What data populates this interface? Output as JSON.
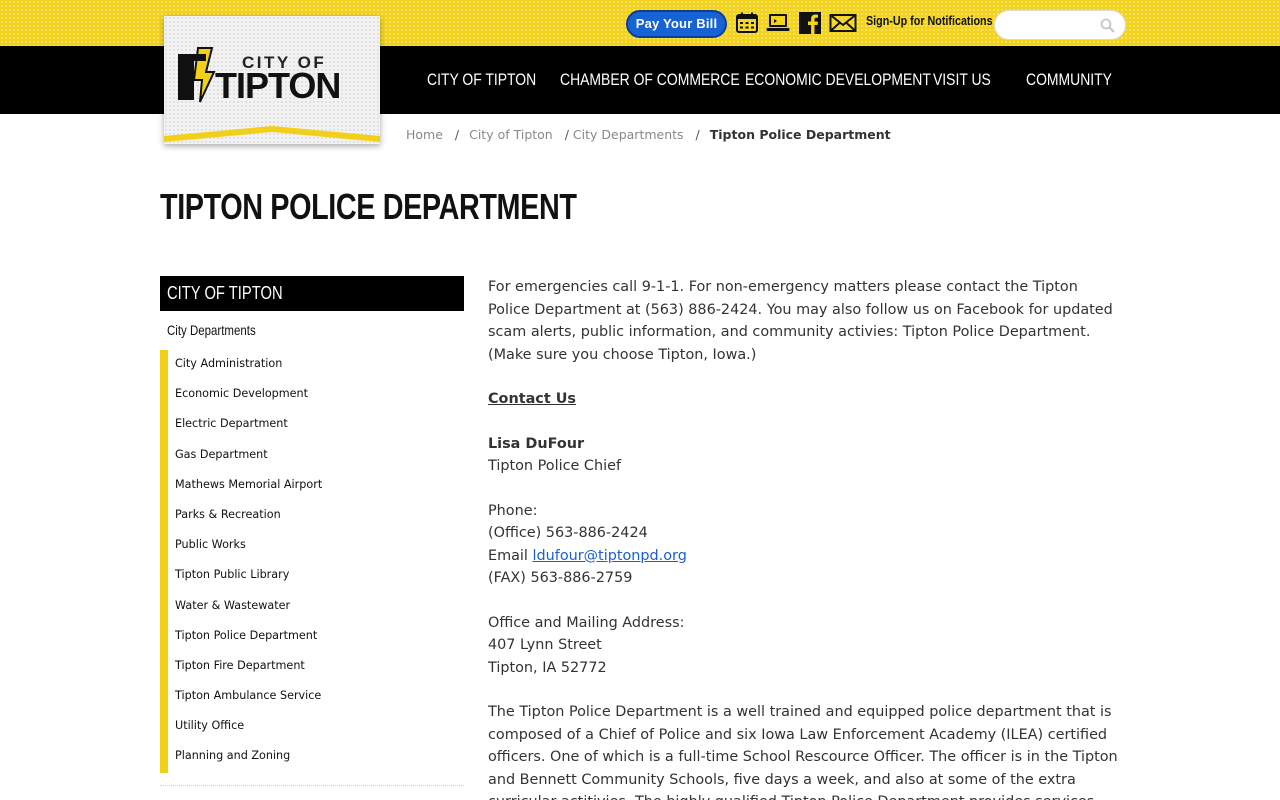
{
  "utility": {
    "pay_bill": "Pay Your Bill",
    "notifications": "Sign-Up for Notifications",
    "search_placeholder": "",
    "icons": [
      "calendar-icon",
      "laptop-icon",
      "facebook-icon",
      "envelope-icon",
      "search-icon"
    ]
  },
  "logo": {
    "line1": "CITY OF",
    "line2": "TIPTON"
  },
  "nav": [
    "City of Tipton",
    "Chamber of Commerce",
    "Economic Development",
    "Visit Us",
    "Community"
  ],
  "breadcrumb": {
    "home": "Home",
    "city": "City of Tipton",
    "departments": "City Departments",
    "current": "Tipton Police Department",
    "separator": "/"
  },
  "page_title": "Tipton Police Department",
  "sidebar": {
    "heading": "City of Tipton",
    "subheading": "City Departments",
    "items": [
      "City Administration",
      "Economic Development",
      "Electric Department",
      "Gas Department",
      "Mathews Memorial Airport",
      "Parks & Recreation",
      "Public Works",
      "Tipton Public Library",
      "Water & Wastewater",
      "Tipton Police Department",
      "Tipton Fire Department",
      "Tipton Ambulance Service",
      "Utility Office",
      "Planning and Zoning"
    ]
  },
  "content": {
    "intro": "For emergencies call 9-1-1. For non-emergency matters please contact the Tipton Police Department at (563) 886-2424.  You may also follow us on Facebook for updated scam alerts, public information, and community activies: Tipton Police Department. (Make sure you choose Tipton, Iowa.)",
    "contact_heading": "Contact Us",
    "chief_name": "Lisa DuFour",
    "chief_title": "Tipton Police Chief",
    "phone_label": "Phone:",
    "office_phone": "(Office) 563-886-2424",
    "email_label": "Email ",
    "email": "ldufour@tiptonpd.org",
    "fax": "(FAX) 563-886-2759",
    "address_label": "Office and Mailing Address:",
    "address_street": "407 Lynn Street",
    "address_city": "Tipton, IA 52772",
    "description": "The Tipton Police Department is a well trained and equipped police department that is composed of a Chief of Police and six Iowa Law Enforcement Academy (ILEA) certified officers. One of which is a full-time School Rescource Officer. The officer is in the Tipton and Bennett Community Schools, five days a week, and also at some of the extra curricular actitivies. The highly qualified Tipton Police Department provides services and"
  },
  "colors": {
    "accent_yellow": "#f3d31b",
    "nav_black": "#000000",
    "pay_blue": "#1763d4",
    "link_blue": "#1a5fd0"
  }
}
